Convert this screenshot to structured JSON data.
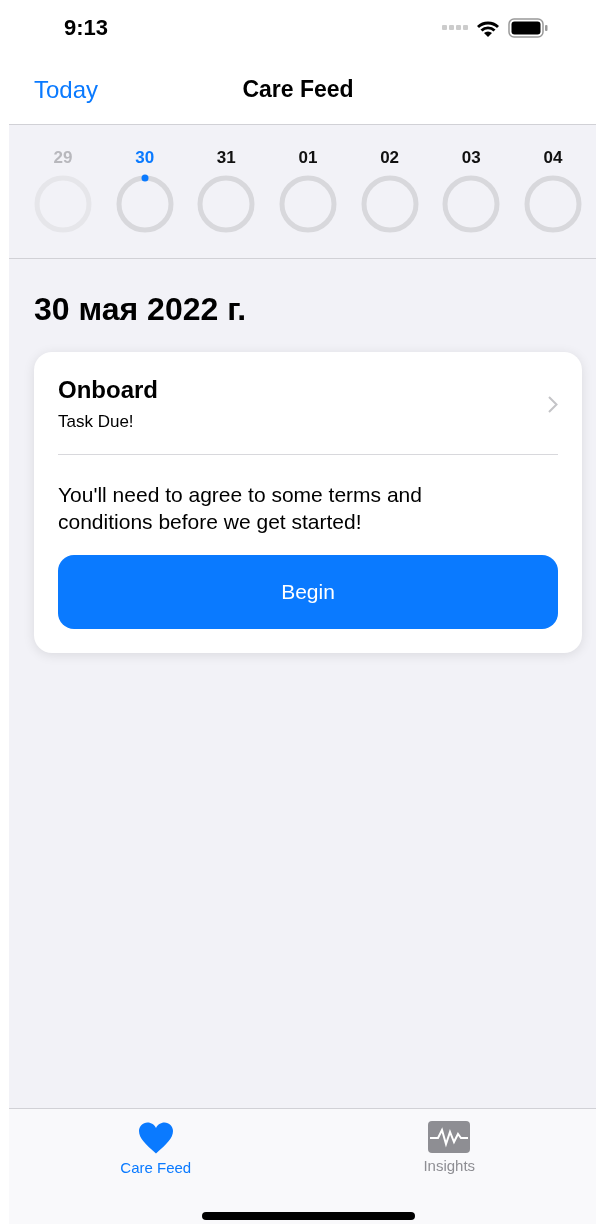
{
  "status_bar": {
    "time": "9:13"
  },
  "nav_bar": {
    "back": "Today",
    "title": "Care Feed"
  },
  "week": [
    {
      "label": "29",
      "selected": false,
      "disabled": true
    },
    {
      "label": "30",
      "selected": true,
      "disabled": false
    },
    {
      "label": "31",
      "selected": false,
      "disabled": false
    },
    {
      "label": "01",
      "selected": false,
      "disabled": false
    },
    {
      "label": "02",
      "selected": false,
      "disabled": false
    },
    {
      "label": "03",
      "selected": false,
      "disabled": false
    },
    {
      "label": "04",
      "selected": false,
      "disabled": false
    }
  ],
  "date_heading": "30 мая 2022 г.",
  "card": {
    "title": "Onboard",
    "subtitle": "Task Due!",
    "body": "You'll need to agree to some terms and conditions before we get started!",
    "button": "Begin"
  },
  "tabs": [
    {
      "label": "Care Feed",
      "kind": "heart",
      "selected": true
    },
    {
      "label": "Insights",
      "kind": "chart",
      "selected": false
    }
  ]
}
